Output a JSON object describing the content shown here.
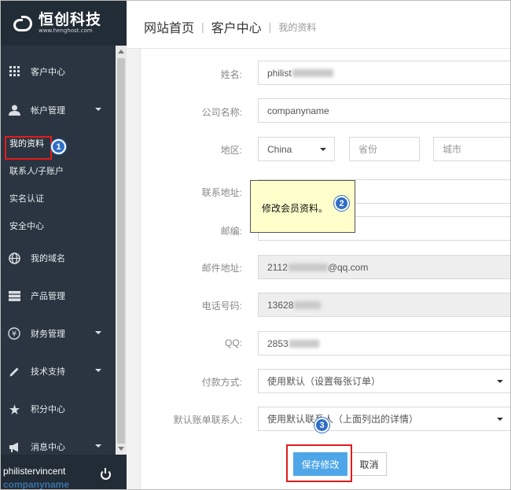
{
  "brand": {
    "name": "恒创科技",
    "domain": "www.henghost.com"
  },
  "sidebar": {
    "items": [
      {
        "label": "客户中心",
        "icon": "grid-icon"
      },
      {
        "label": "帐户管理",
        "icon": "user-icon",
        "expanded": true
      },
      {
        "label": "我的域名",
        "icon": "globe-icon"
      },
      {
        "label": "产品管理",
        "icon": "server-icon"
      },
      {
        "label": "财务管理",
        "icon": "yen-icon"
      },
      {
        "label": "技术支持",
        "icon": "pencil-icon"
      },
      {
        "label": "积分中心",
        "icon": "star-icon"
      },
      {
        "label": "消息中心",
        "icon": "megaphone-icon"
      }
    ],
    "sub_items": [
      {
        "label": "我的资料",
        "active": true
      },
      {
        "label": "联系人/子账户"
      },
      {
        "label": "实名认证"
      },
      {
        "label": "安全中心"
      }
    ],
    "user": {
      "name": "philistervincent",
      "company": "companyname"
    }
  },
  "breadcrumb": {
    "home": "网站首页",
    "center": "客户中心",
    "current": "我的资料"
  },
  "form": {
    "name": {
      "label": "姓名:",
      "value": "philist"
    },
    "company": {
      "label": "公司名称:",
      "value": "companyname"
    },
    "region": {
      "label": "地区:",
      "country": "China",
      "province_placeholder": "省份",
      "city_placeholder": "城市"
    },
    "address": {
      "label": "联系地址:"
    },
    "zip": {
      "label": "邮编:"
    },
    "email": {
      "label": "邮件地址:",
      "prefix": "2112",
      "suffix": "@qq.com"
    },
    "phone": {
      "label": "电话号码:",
      "value": "13628"
    },
    "qq": {
      "label": "QQ:",
      "value": "2853"
    },
    "payment": {
      "label": "付款方式:",
      "value": "使用默认（设置每张订单）"
    },
    "billing_contact": {
      "label": "默认账单联系人:",
      "value": "使用默认联系人（上面列出的详情）"
    }
  },
  "tooltip": {
    "text": "修改会员资料。"
  },
  "badges": {
    "one": "1",
    "two": "2",
    "three": "3"
  },
  "buttons": {
    "save": "保存修改",
    "cancel": "取消"
  },
  "colors": {
    "sidebar": "#2a3541",
    "accent": "#4ea6e8",
    "highlight": "#e31b1b",
    "badge": "#2f6ec5",
    "tooltip": "#ffffcc"
  }
}
